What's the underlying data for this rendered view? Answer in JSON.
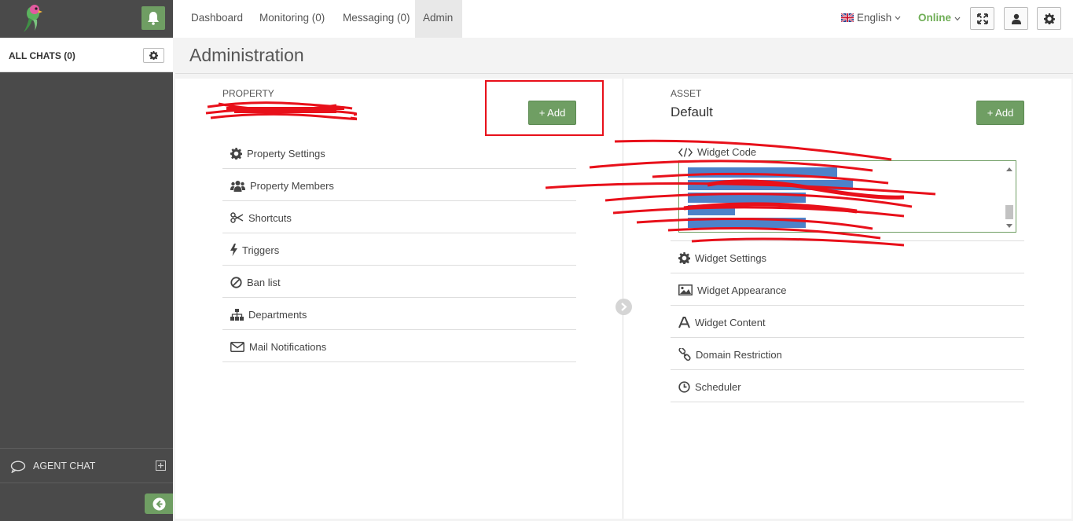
{
  "topnav": {
    "items": [
      {
        "label": "Dashboard",
        "active": false
      },
      {
        "label": "Monitoring (0)",
        "active": false
      },
      {
        "label": "Messaging (0)",
        "active": false
      },
      {
        "label": "Admin",
        "active": true
      }
    ],
    "language": "English",
    "status": "Online"
  },
  "sidebar": {
    "all_chats": "ALL CHATS (0)",
    "agent_chat": "AGENT CHAT"
  },
  "page": {
    "title": "Administration"
  },
  "property": {
    "section_label": "PROPERTY",
    "add_label": "+ Add",
    "menu": [
      {
        "label": "Property Settings",
        "icon": "gear-icon"
      },
      {
        "label": "Property Members",
        "icon": "users-icon"
      },
      {
        "label": "Shortcuts",
        "icon": "scissors-icon"
      },
      {
        "label": "Triggers",
        "icon": "bolt-icon"
      },
      {
        "label": "Ban list",
        "icon": "ban-icon"
      },
      {
        "label": "Departments",
        "icon": "sitemap-icon"
      },
      {
        "label": "Mail Notifications",
        "icon": "envelope-icon"
      }
    ]
  },
  "asset": {
    "section_label": "ASSET",
    "name": "Default",
    "add_label": "+ Add",
    "widget_code_label": "Widget Code",
    "menu": [
      {
        "label": "Widget Settings",
        "icon": "gear-icon"
      },
      {
        "label": "Widget Appearance",
        "icon": "image-icon"
      },
      {
        "label": "Widget Content",
        "icon": "font-icon"
      },
      {
        "label": "Domain Restriction",
        "icon": "link-icon"
      },
      {
        "label": "Scheduler",
        "icon": "clock-icon"
      }
    ]
  },
  "colors": {
    "accent_green": "#6f9e63",
    "online_green": "#6fae56",
    "sidebar_bg": "#4a4a4a",
    "annotation_red": "#e8101a"
  }
}
